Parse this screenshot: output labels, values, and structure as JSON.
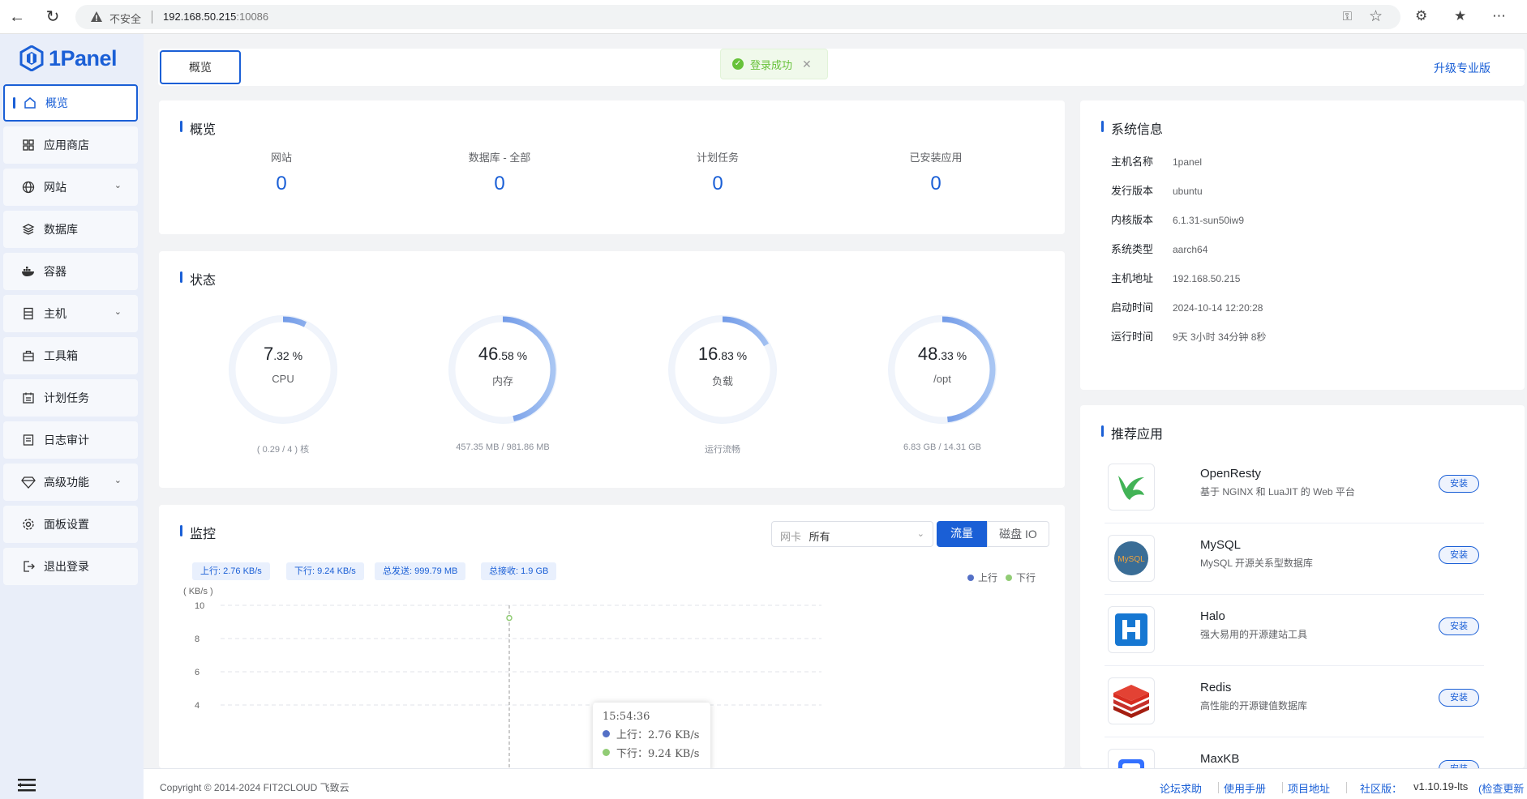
{
  "browser": {
    "insecure_label": "不安全",
    "url_host": "192.168.50.215",
    "url_port": ":10086"
  },
  "brand": {
    "name": "1Panel",
    "color": "#1a5fd6"
  },
  "sidebar": {
    "items": [
      {
        "label": "概览",
        "icon": "home-icon",
        "active": true
      },
      {
        "label": "应用商店",
        "icon": "grid-icon"
      },
      {
        "label": "网站",
        "icon": "globe-icon",
        "expandable": true
      },
      {
        "label": "数据库",
        "icon": "layers-icon"
      },
      {
        "label": "容器",
        "icon": "docker-icon"
      },
      {
        "label": "主机",
        "icon": "server-icon",
        "expandable": true
      },
      {
        "label": "工具箱",
        "icon": "toolbox-icon"
      },
      {
        "label": "计划任务",
        "icon": "calendar-icon"
      },
      {
        "label": "日志审计",
        "icon": "log-icon"
      },
      {
        "label": "高级功能",
        "icon": "diamond-icon",
        "expandable": true
      },
      {
        "label": "面板设置",
        "icon": "gear-icon"
      },
      {
        "label": "退出登录",
        "icon": "logout-icon"
      }
    ]
  },
  "header": {
    "tab": "概览",
    "upgrade": "升级专业版"
  },
  "toast": {
    "message": "登录成功"
  },
  "overview": {
    "title": "概览",
    "stats": [
      {
        "label": "网站",
        "value": "0"
      },
      {
        "label": "数据库 - 全部",
        "value": "0"
      },
      {
        "label": "计划任务",
        "value": "0"
      },
      {
        "label": "已安装应用",
        "value": "0"
      }
    ]
  },
  "status": {
    "title": "状态",
    "gauges": [
      {
        "int": "7",
        "dec": ".32 %",
        "name": "CPU",
        "sub": "( 0.29 / 4 ) 核",
        "percent": 7.32
      },
      {
        "int": "46",
        "dec": ".58 %",
        "name": "内存",
        "sub": "457.35 MB / 981.86 MB",
        "percent": 46.58
      },
      {
        "int": "16",
        "dec": ".83 %",
        "name": "负载",
        "sub": "运行流畅",
        "percent": 16.83
      },
      {
        "int": "48",
        "dec": ".33 %",
        "name": "/opt",
        "sub": "6.83 GB / 14.31 GB",
        "percent": 48.33
      }
    ]
  },
  "monitor": {
    "title": "监控",
    "nic_label": "网卡",
    "nic_value": "所有",
    "tab_traffic": "流量",
    "tab_disk": "磁盘 IO",
    "badges": {
      "up": "上行: 2.76 KB/s",
      "down": "下行: 9.24 KB/s",
      "sent": "总发送: 999.79 MB",
      "recv": "总接收: 1.9 GB"
    },
    "legend_up": "上行",
    "legend_down": "下行",
    "unit": "( KB/s )",
    "tooltip": {
      "time": "15:54:36",
      "up": "上行：2.76 KB/s",
      "down": "下行：9.24 KB/s"
    }
  },
  "chart_data": {
    "type": "line",
    "ylabel": "( KB/s )",
    "ylim": [
      4,
      10
    ],
    "yticks": [
      "10",
      "8",
      "6",
      "4"
    ],
    "x": [
      "15:54:36"
    ],
    "series": [
      {
        "name": "上行",
        "values": [
          2.76
        ],
        "color": "#5470c6"
      },
      {
        "name": "下行",
        "values": [
          9.24
        ],
        "color": "#91cc75"
      }
    ],
    "legend": "top-right",
    "grid": true
  },
  "sysinfo": {
    "title": "系统信息",
    "rows": [
      {
        "k": "主机名称",
        "v": "1panel"
      },
      {
        "k": "发行版本",
        "v": "ubuntu"
      },
      {
        "k": "内核版本",
        "v": "6.1.31-sun50iw9"
      },
      {
        "k": "系统类型",
        "v": "aarch64"
      },
      {
        "k": "主机地址",
        "v": "192.168.50.215"
      },
      {
        "k": "启动时间",
        "v": "2024-10-14 12:20:28"
      },
      {
        "k": "运行时间",
        "v": "9天 3小时 34分钟 8秒"
      }
    ]
  },
  "apps": {
    "title": "推荐应用",
    "install_label": "安装",
    "items": [
      {
        "name": "OpenResty",
        "desc": "基于 NGINX 和 LuaJIT 的 Web 平台",
        "icon": "openresty-icon"
      },
      {
        "name": "MySQL",
        "desc": "MySQL 开源关系型数据库",
        "icon": "mysql-icon"
      },
      {
        "name": "Halo",
        "desc": "强大易用的开源建站工具",
        "icon": "halo-icon"
      },
      {
        "name": "Redis",
        "desc": "高性能的开源键值数据库",
        "icon": "redis-icon"
      },
      {
        "name": "MaxKB",
        "desc": "",
        "icon": "maxkb-icon"
      }
    ]
  },
  "footer": {
    "copyright": "Copyright © 2014-2024 FIT2CLOUD 飞致云",
    "forum": "论坛求助",
    "manual": "使用手册",
    "project": "项目地址",
    "edition": "社区版：",
    "version": "v1.10.19-lts",
    "check_update": "(检查更新"
  }
}
